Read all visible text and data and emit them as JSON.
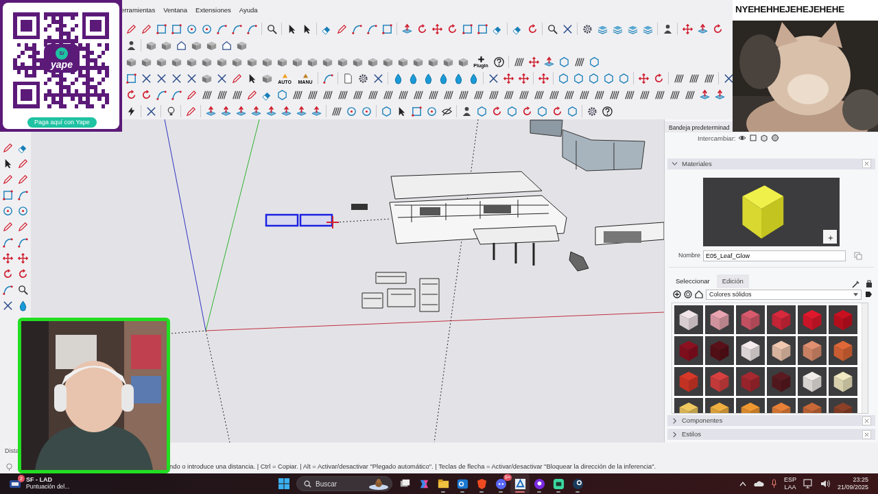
{
  "menu": [
    {
      "label": "erramientas"
    },
    {
      "label": "Ventana"
    },
    {
      "label": "Extensiones"
    },
    {
      "label": "Ayuda"
    }
  ],
  "toolbar_captions": {
    "plugin": "Plugin",
    "auto": "AUTO",
    "manual": "MANU"
  },
  "tray": {
    "title": "Bandeja predeterminad",
    "swap_label": "Intercambiar:",
    "panels": [
      {
        "title": "Materiales",
        "expanded": true
      },
      {
        "title": "Componentes",
        "expanded": false
      },
      {
        "title": "Estilos",
        "expanded": false
      }
    ],
    "materials": {
      "name_label": "Nombre",
      "name_value": "E05_Leaf_Glow",
      "tabs": [
        {
          "label": "Seleccionar",
          "selected": true
        },
        {
          "label": "Edición",
          "selected": false
        }
      ],
      "library": "Colores sólidos",
      "swatches": [
        {
          "color": "#f0e4e8"
        },
        {
          "color": "#e8a4b0"
        },
        {
          "color": "#d85a6c"
        },
        {
          "color": "#d8283c"
        },
        {
          "color": "#e0182c"
        },
        {
          "color": "#c81020"
        },
        {
          "color": "#8c1020"
        },
        {
          "color": "#5a1018"
        },
        {
          "color": "#f4ecec"
        },
        {
          "color": "#f0c8b0"
        },
        {
          "color": "#e09070"
        },
        {
          "color": "#e06838"
        },
        {
          "color": "#d83828"
        },
        {
          "color": "#d84040"
        },
        {
          "color": "#a82830"
        },
        {
          "color": "#5a1a20"
        },
        {
          "color": "#f0ece8"
        },
        {
          "color": "#f0e8c0"
        },
        {
          "color": "#f0c860"
        },
        {
          "color": "#f0b040"
        },
        {
          "color": "#f09830"
        },
        {
          "color": "#e88038"
        },
        {
          "color": "#c86838"
        },
        {
          "color": "#8c4028"
        }
      ]
    }
  },
  "status_bar": {
    "measurement_label": "Dista",
    "hint": "ndo o introduce una distancia. | Ctrl = Copiar. | Alt = Activar/desactivar \"Plegado automático\". | Teclas de flecha = Activar/desactivar \"Bloquear la dirección de la inferencia\"."
  },
  "taskbar": {
    "notification": {
      "badge": "2",
      "title": "SF - LAD",
      "subtitle": "Puntuación del..."
    },
    "search_label": "Buscar",
    "apps": [
      {
        "kind": "taskview",
        "running": false,
        "active": false
      },
      {
        "kind": "copilot",
        "running": false,
        "active": false
      },
      {
        "kind": "folder",
        "running": true,
        "active": false
      },
      {
        "kind": "mail",
        "running": true,
        "active": false
      },
      {
        "kind": "browser",
        "running": true,
        "active": false
      },
      {
        "kind": "chat",
        "running": true,
        "active": false,
        "badge": "9+"
      },
      {
        "kind": "modeler",
        "running": true,
        "active": true
      },
      {
        "kind": "player",
        "running": true,
        "active": false
      },
      {
        "kind": "game",
        "running": true,
        "active": false
      },
      {
        "kind": "steam",
        "running": true,
        "active": false
      }
    ],
    "language": "ESP",
    "layout": "LAA",
    "time": "23:25",
    "date": "21/09/2025"
  },
  "overlays": {
    "qr": {
      "currency": "S/",
      "brand": "yape",
      "button": "Paga aquí con Yape"
    },
    "caption": "NYEHEHHEJEHEJEHEHE"
  }
}
